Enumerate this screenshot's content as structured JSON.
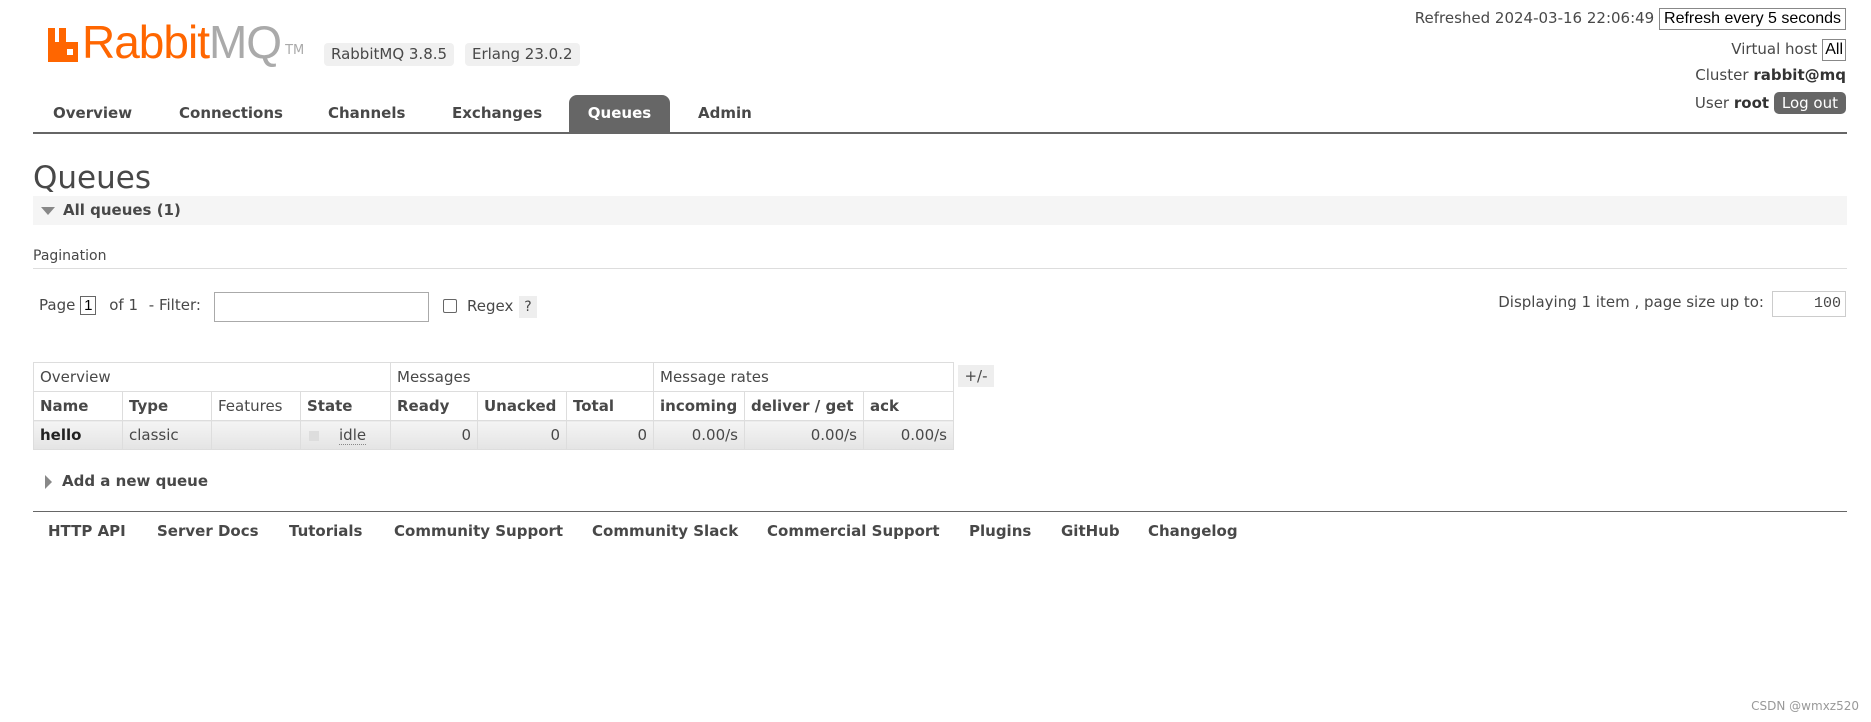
{
  "logo": {
    "part1": "Rabbit",
    "part2": "MQ",
    "tm": "TM",
    "brand_color": "#ff6600"
  },
  "versions": [
    "RabbitMQ 3.8.5",
    "Erlang 23.0.2"
  ],
  "nav": [
    "Overview",
    "Connections",
    "Channels",
    "Exchanges",
    "Queues",
    "Admin"
  ],
  "active_tab": "Queues",
  "status": {
    "refreshed_label": "Refreshed 2024-03-16 22:06:49",
    "refresh_select": "Refresh every 5 seconds",
    "vhost_label": "Virtual host",
    "vhost_value": "All",
    "cluster_label": "Cluster",
    "cluster_value": "rabbit@mq",
    "user_label": "User",
    "user_value": "root",
    "logout": "Log out"
  },
  "page_title": "Queues",
  "all_queues": "All queues (1)",
  "pagination": {
    "heading": "Pagination",
    "page_label": "Page",
    "page_value": "1",
    "of_label": "of 1",
    "filter_label": "- Filter:",
    "filter_value": "",
    "regex_label": "Regex",
    "regex_checked": false,
    "help": "?",
    "displaying": "Displaying 1 item , page size up to:",
    "page_size": "100"
  },
  "table": {
    "groups": [
      "Overview",
      "Messages",
      "Message rates"
    ],
    "columns": [
      "Name",
      "Type",
      "Features",
      "State",
      "Ready",
      "Unacked",
      "Total",
      "incoming",
      "deliver / get",
      "ack"
    ],
    "rows": [
      {
        "name": "hello",
        "type": "classic",
        "features": "",
        "state": "idle",
        "ready": "0",
        "unacked": "0",
        "total": "0",
        "incoming": "0.00/s",
        "deliver_get": "0.00/s",
        "ack": "0.00/s"
      }
    ],
    "toggle": "+/-"
  },
  "add_queue": "Add a new queue",
  "footer": [
    "HTTP API",
    "Server Docs",
    "Tutorials",
    "Community Support",
    "Community Slack",
    "Commercial Support",
    "Plugins",
    "GitHub",
    "Changelog"
  ],
  "watermark": "CSDN @wmxz520"
}
